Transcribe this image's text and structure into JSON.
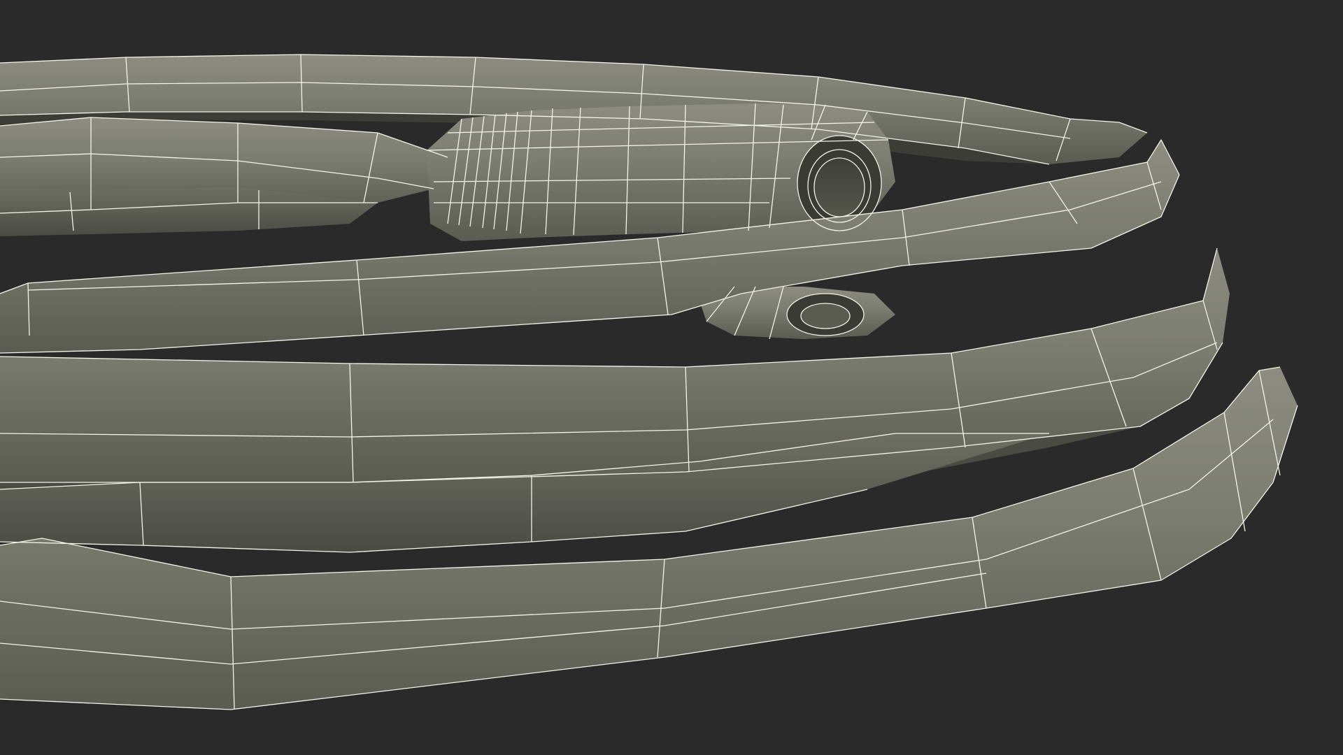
{
  "scene": {
    "subject": "coiled-hose-wireframe",
    "colors": {
      "background": "#2a2a2a",
      "surface_light": "#8a8b7e",
      "surface_mid": "#76776b",
      "surface_dark": "#55564d",
      "inner_shadow": "#3c3d37",
      "wire": "#f4f4ea"
    }
  }
}
